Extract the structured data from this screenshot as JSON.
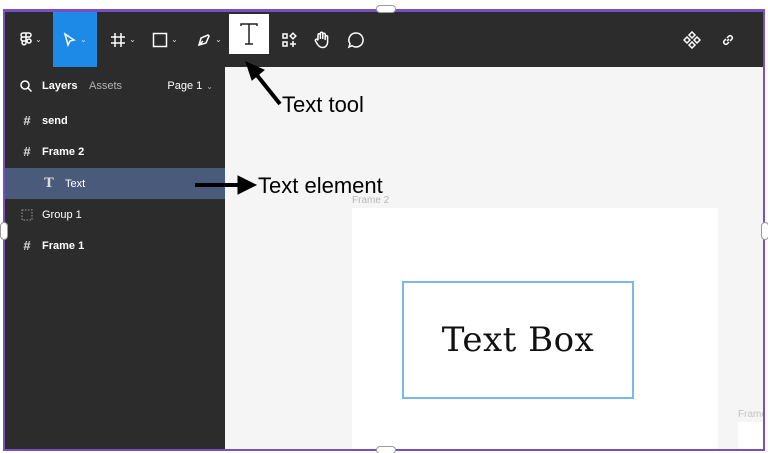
{
  "toolbar": {
    "tools": [
      "figma-menu",
      "move",
      "frame",
      "shape",
      "pen",
      "text",
      "resources",
      "hand",
      "comment",
      "component",
      "link"
    ]
  },
  "sidebar": {
    "tabs": {
      "layers": "Layers",
      "assets": "Assets"
    },
    "page": "Page 1",
    "layers": [
      {
        "label": "send",
        "icon": "frame-icon"
      },
      {
        "label": "Frame 2",
        "icon": "frame-icon"
      },
      {
        "label": "Text",
        "icon": "text-icon",
        "selected": true
      },
      {
        "label": "Group 1",
        "icon": "group-icon"
      },
      {
        "label": "Frame 1",
        "icon": "frame-icon"
      }
    ]
  },
  "canvas": {
    "frame_label": "Frame 2",
    "text_box": "Text Box",
    "edge_frame_label": "Frame"
  },
  "annotations": {
    "text_tool": "Text tool",
    "text_element": "Text element"
  },
  "colors": {
    "toolbar_bg": "#2c2c2c",
    "active_tool": "#1e8ae8",
    "selected_layer": "#495a7a",
    "outer_border": "#7b4fc4",
    "text_box_border": "#79b8e8"
  }
}
